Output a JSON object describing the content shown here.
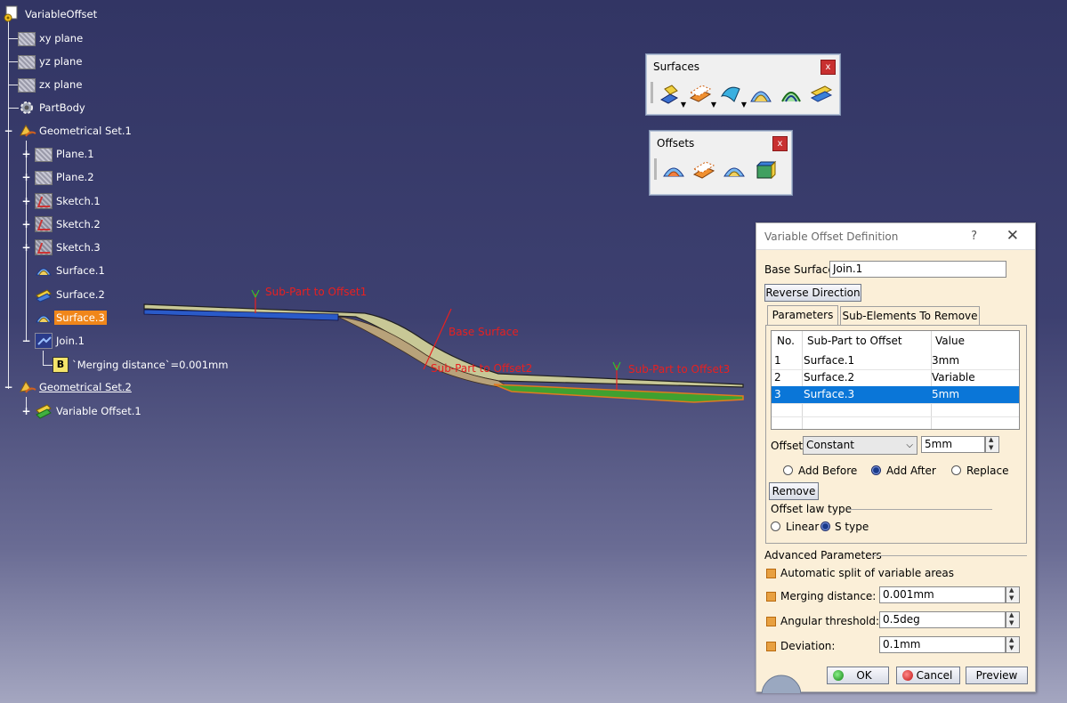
{
  "tree": {
    "root": "VariableOffset",
    "items": [
      {
        "label": "xy plane"
      },
      {
        "label": "yz plane"
      },
      {
        "label": "zx plane"
      },
      {
        "label": "PartBody"
      },
      {
        "label": "Geometrical Set.1"
      },
      {
        "label": "Plane.1"
      },
      {
        "label": "Plane.2"
      },
      {
        "label": "Sketch.1"
      },
      {
        "label": "Sketch.2"
      },
      {
        "label": "Sketch.3"
      },
      {
        "label": "Surface.1"
      },
      {
        "label": "Surface.2"
      },
      {
        "label": "Surface.3"
      },
      {
        "label": "Join.1"
      },
      {
        "label": "`Merging distance`=0.001mm"
      },
      {
        "label": "Geometrical Set.2"
      },
      {
        "label": "Variable Offset.1"
      }
    ],
    "param_icon_letter": "B"
  },
  "annotations": {
    "sub1": "Sub-Part to Offset1",
    "base": "Base Surface",
    "sub2": "Sub-Part to Offset2",
    "sub3": "Sub-Part to Offset3"
  },
  "toolbars": {
    "surfaces": {
      "title": "Surfaces",
      "close": "x"
    },
    "offsets": {
      "title": "Offsets",
      "close": "x"
    }
  },
  "dialog": {
    "title": "Variable Offset Definition",
    "help": "?",
    "close": "✕",
    "base_surface_label": "Base Surface:",
    "base_surface_value": "Join.1",
    "reverse_direction": "Reverse Direction",
    "tabs": [
      "Parameters",
      "Sub-Elements To Remove"
    ],
    "table": {
      "headers": [
        "No.",
        "Sub-Part to Offset",
        "Value"
      ],
      "rows": [
        {
          "no": "1",
          "part": "Surface.1",
          "value": "3mm"
        },
        {
          "no": "2",
          "part": "Surface.2",
          "value": "Variable"
        },
        {
          "no": "3",
          "part": "Surface.3",
          "value": "5mm"
        }
      ],
      "selected_row": 3
    },
    "offset_label": "Offset:",
    "offset_mode": "Constant",
    "offset_value": "5mm",
    "add_before": "Add Before",
    "add_after": "Add After",
    "replace": "Replace",
    "remove": "Remove",
    "law_type_label": "Offset law type",
    "linear": "Linear",
    "s_type": "S type",
    "advanced_label": "Advanced Parameters",
    "auto_split": "Automatic split of variable areas",
    "merging_label": "Merging distance:",
    "merging_value": "0.001mm",
    "angular_label": "Angular threshold:",
    "angular_value": "0.5deg",
    "deviation_label": "Deviation:",
    "deviation_value": "0.1mm",
    "ok": "OK",
    "cancel": "Cancel",
    "preview": "Preview"
  },
  "colors": {
    "background_top": "#323564",
    "background_bottom": "#a4a6c0",
    "selection": "#f0861a",
    "dialog_bg": "#fbefd8",
    "annotation": "#e82020",
    "row_selected": "#0a76d8"
  }
}
